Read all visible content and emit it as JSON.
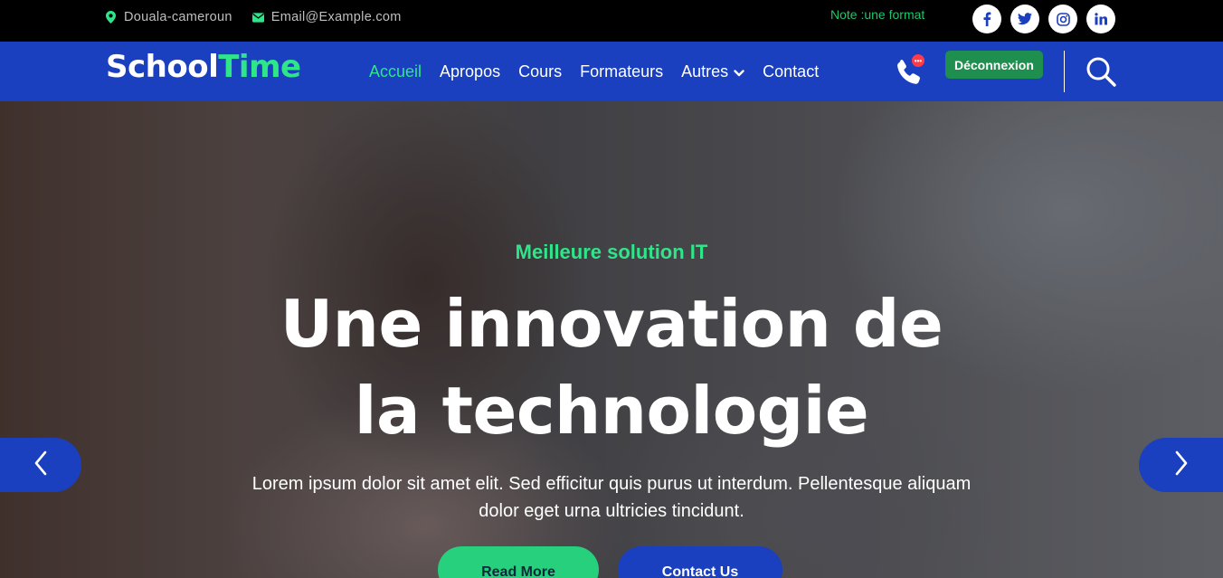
{
  "topbar": {
    "location": "Douala-cameroun",
    "email": "Email@Example.com",
    "note": "Note :une format",
    "socials": [
      {
        "icon": "facebook-icon",
        "glyph": "f"
      },
      {
        "icon": "twitter-icon",
        "glyph": "t"
      },
      {
        "icon": "instagram-icon",
        "glyph": "◎"
      },
      {
        "icon": "linkedin-icon",
        "glyph": "in"
      }
    ]
  },
  "nav": {
    "logo_part1": "School",
    "logo_part2": "Time",
    "items": [
      {
        "label": "Accueil",
        "active": true
      },
      {
        "label": "Apropos"
      },
      {
        "label": "Cours"
      },
      {
        "label": "Formateurs"
      },
      {
        "label": "Autres",
        "has_dropdown": true
      },
      {
        "label": "Contact"
      }
    ],
    "logout_label": "Déconnexion"
  },
  "hero": {
    "kicker": "Meilleure solution IT",
    "title": "Une innovation de la technologie",
    "description": "Lorem ipsum dolor sit amet elit. Sed efficitur quis purus ut interdum. Pellentesque aliquam dolor eget urna ultricies tincidunt.",
    "read_more": "Read More",
    "contact_us": "Contact Us"
  },
  "colors": {
    "brand_blue": "#1a3fbf",
    "accent_green": "#2ee58a",
    "topbar_bg": "#000000"
  }
}
